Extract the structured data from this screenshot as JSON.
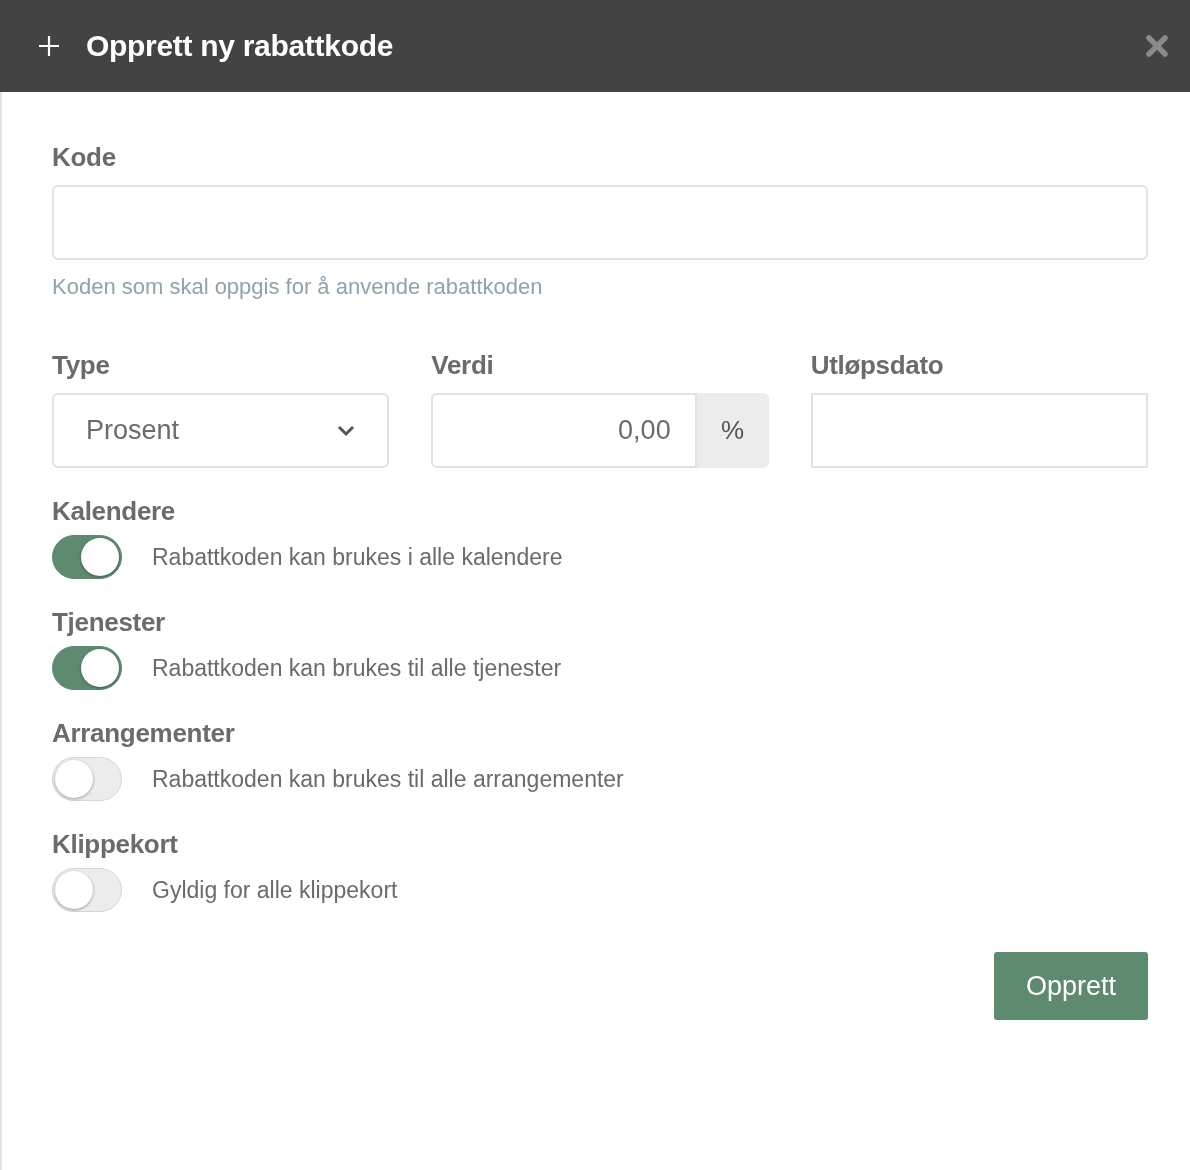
{
  "dialog": {
    "title": "Opprett ny rabattkode"
  },
  "code_field": {
    "label": "Kode",
    "help": "Koden som skal oppgis for å anvende rabattkoden"
  },
  "type_field": {
    "label": "Type",
    "value": "Prosent"
  },
  "value_field": {
    "label": "Verdi",
    "value": "0,00",
    "unit": "%"
  },
  "expiry_field": {
    "label": "Utløpsdato"
  },
  "toggles": [
    {
      "label": "Kalendere",
      "description": "Rabattkoden kan brukes i alle kalendere",
      "on": true
    },
    {
      "label": "Tjenester",
      "description": "Rabattkoden kan brukes til alle tjenester",
      "on": true
    },
    {
      "label": "Arrangementer",
      "description": "Rabattkoden kan brukes til alle arrangementer",
      "on": false
    },
    {
      "label": "Klippekort",
      "description": "Gyldig for alle klippekort",
      "on": false
    }
  ],
  "submit_button": "Opprett"
}
